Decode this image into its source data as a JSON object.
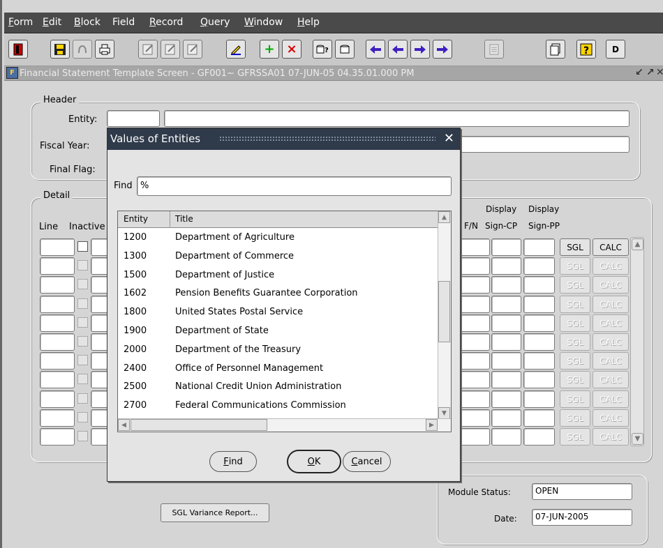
{
  "menu": {
    "items": [
      {
        "label": "Form",
        "mnemonic": "F",
        "rest": "orm"
      },
      {
        "label": "Edit",
        "mnemonic": "E",
        "rest": "dit"
      },
      {
        "label": "Block",
        "mnemonic": "B",
        "rest": "lock"
      },
      {
        "label": "Field",
        "mnemonic": "",
        "rest": "Field"
      },
      {
        "label": "Record",
        "mnemonic": "R",
        "rest": "ecord"
      },
      {
        "label": "Query",
        "mnemonic": "Q",
        "rest": "uery"
      },
      {
        "label": "Window",
        "mnemonic": "W",
        "rest": "indow"
      },
      {
        "label": "Help",
        "mnemonic": "H",
        "rest": "elp"
      }
    ]
  },
  "toolbar": {
    "icons": [
      "exit-icon",
      "save-icon",
      "print-setup-icon",
      "print-icon",
      "clear-form-icon",
      "clear-block-icon",
      "clear-record-icon",
      "edit-icon",
      "insert-record-icon",
      "delete-record-icon",
      "enter-query-icon",
      "execute-query-icon",
      "previous-block-icon",
      "previous-record-icon",
      "next-record-icon",
      "next-block-icon",
      "list-icon",
      "attachments-icon",
      "help-icon"
    ],
    "d_label": "D",
    "insert_glyph": "+",
    "delete_glyph": "×"
  },
  "window": {
    "title": "Financial Statement Template Screen - GF001~ GFRSSA01  07-JUN-05 04.35.01.000 PM"
  },
  "header": {
    "group_label": "Header",
    "entity_label": "Entity:",
    "fiscal_year_label": "Fiscal Year:",
    "final_flag_label": "Final Flag:"
  },
  "detail": {
    "group_label": "Detail",
    "line_label": "Line",
    "inactive_label": "Inactive",
    "fn_label": "F/N",
    "display1": "Display",
    "display2": "Display",
    "sign_cp": "Sign-CP",
    "sign_pp": "Sign-PP",
    "sgl_label": "SGL",
    "calc_label": "CALC"
  },
  "footer": {
    "sgl_variance_button": "SGL Variance Report...",
    "module_status_label": "Module Status:",
    "module_status_value": "OPEN",
    "date_label": "Date:",
    "date_value": "07-JUN-2005"
  },
  "dialog": {
    "title": "Values of Entities",
    "find_label": "Find",
    "find_value": "%",
    "columns": {
      "entity": "Entity",
      "title": "Title"
    },
    "rows": [
      {
        "entity": "1200",
        "title": "Department of Agriculture"
      },
      {
        "entity": "1300",
        "title": "Department of Commerce"
      },
      {
        "entity": "1500",
        "title": "Department of Justice"
      },
      {
        "entity": "1602",
        "title": "Pension Benefits Guarantee Corporation"
      },
      {
        "entity": "1800",
        "title": "United States Postal Service"
      },
      {
        "entity": "1900",
        "title": "Department of State"
      },
      {
        "entity": "2000",
        "title": "Department of the Treasury"
      },
      {
        "entity": "2400",
        "title": "Office of Personnel Management"
      },
      {
        "entity": "2500",
        "title": "National Credit Union Administration"
      },
      {
        "entity": "2700",
        "title": "Federal Communications Commission"
      }
    ],
    "buttons": {
      "find": {
        "mnemonic": "F",
        "rest": "ind"
      },
      "ok": {
        "mnemonic": "O",
        "rest": "K"
      },
      "cancel": {
        "mnemonic": "C",
        "rest": "ancel"
      }
    }
  }
}
